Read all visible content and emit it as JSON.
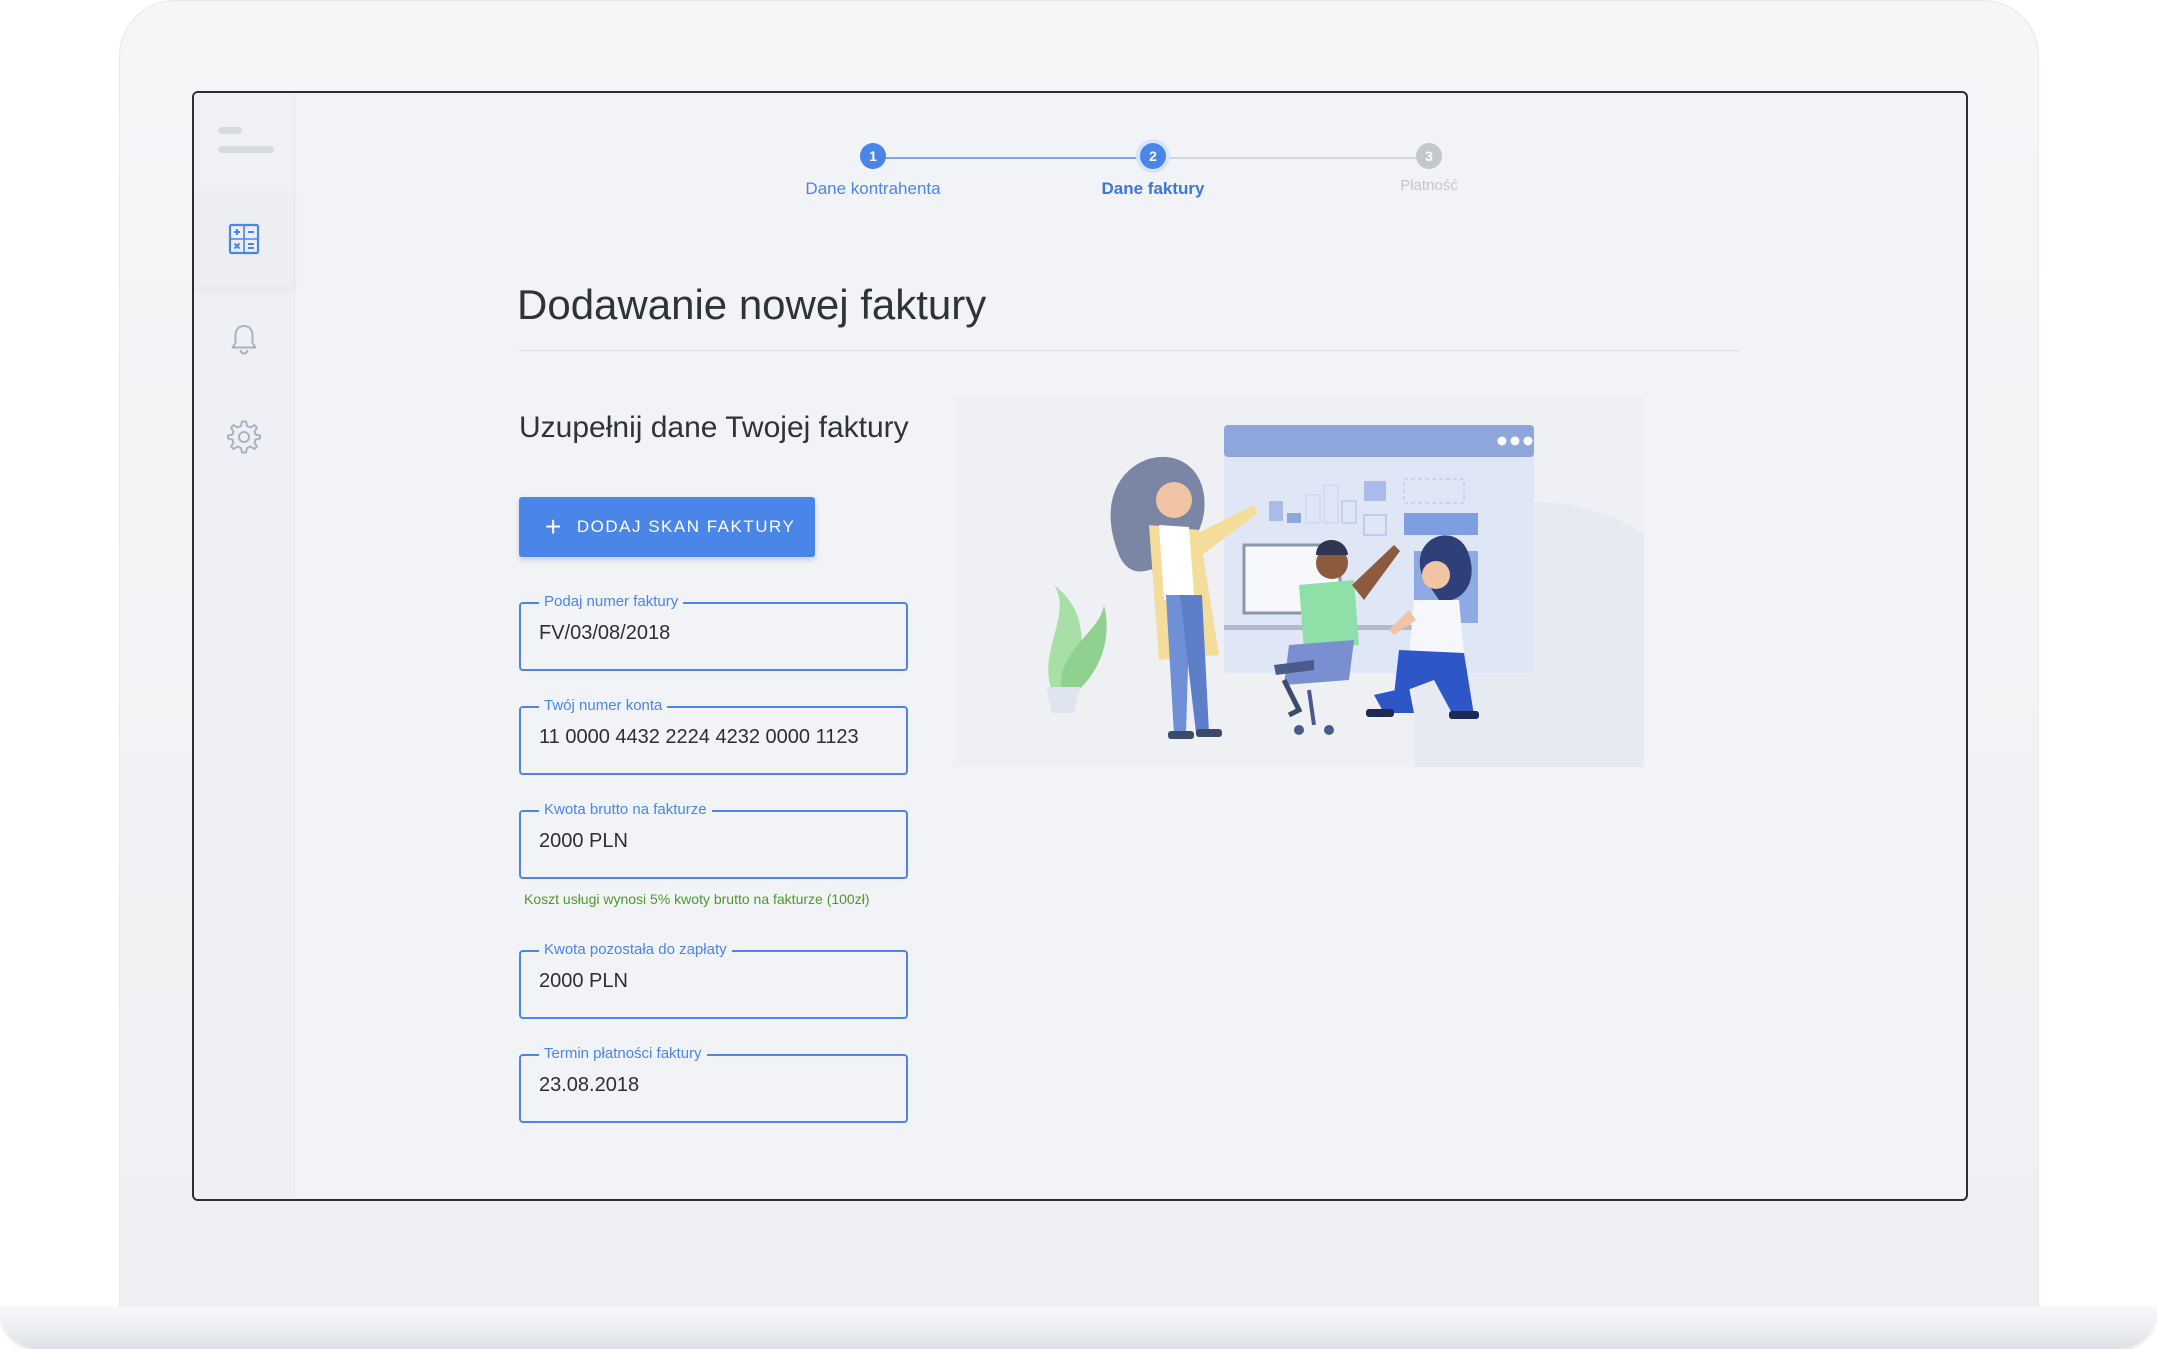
{
  "sidebar": {
    "items": [
      {
        "icon": "calculator-icon",
        "active": true
      },
      {
        "icon": "bell-icon",
        "active": false
      },
      {
        "icon": "gear-icon",
        "active": false
      }
    ]
  },
  "stepper": {
    "steps": [
      {
        "number": "1",
        "label": "Dane kontrahenta",
        "state": "done"
      },
      {
        "number": "2",
        "label": "Dane faktury",
        "state": "active"
      },
      {
        "number": "3",
        "label": "Płatność",
        "state": "pending"
      }
    ]
  },
  "page": {
    "title": "Dodawanie nowej faktury",
    "subtitle": "Uzupełnij dane Twojej faktury"
  },
  "add_button": {
    "label": "DODAJ SKAN FAKTURY",
    "icon": "plus-icon"
  },
  "form": {
    "fields": [
      {
        "label": "Podaj numer faktury",
        "value": "FV/03/08/2018"
      },
      {
        "label": "Twój numer konta",
        "value": "11 0000 4432 2224 4232 0000 1123"
      },
      {
        "label": "Kwota brutto na fakturze",
        "value": "2000 PLN"
      },
      {
        "label": "Kwota pozostała do zapłaty",
        "value": "2000 PLN"
      },
      {
        "label": "Termin płatności faktury",
        "value": "23.08.2018"
      }
    ],
    "hint": "Koszt usługi wynosi 5% kwoty brutto na fakturze (100zł)"
  },
  "colors": {
    "accent": "#4a86e8",
    "hint": "#4c9a2a",
    "text": "#2f3238",
    "pending": "#c4c7cc"
  }
}
